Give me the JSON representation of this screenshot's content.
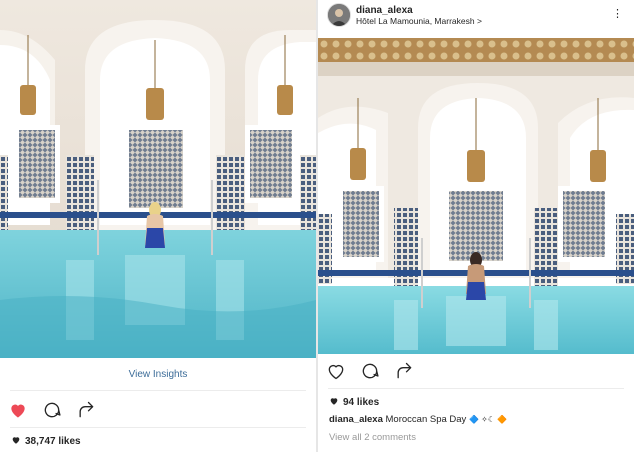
{
  "left_post": {
    "photo_alt": "",
    "view_insights": "View Insights",
    "likes_count": "38,747 likes",
    "liked": true
  },
  "right_post": {
    "username": "diana_alexa",
    "location": "Hôtel La Mamounia, Marrakesh",
    "location_chevron": ">",
    "more": "⋮",
    "likes_count": "94 likes",
    "caption_user": "diana_alexa",
    "caption_text": "Moroccan Spa Day",
    "caption_emoji": "🔷 ✧☾ 🔶",
    "comments_link": "View all 2 comments",
    "cut_text": "",
    "liked": false
  },
  "colors": {
    "link": "#3d6d99",
    "heart_red": "#ed4956",
    "pool": "#5fc0cf",
    "tile_blue": "#2a4f8c"
  },
  "icons": [
    "heart-icon",
    "comment-icon",
    "share-icon",
    "small-heart-icon",
    "more-icon"
  ]
}
